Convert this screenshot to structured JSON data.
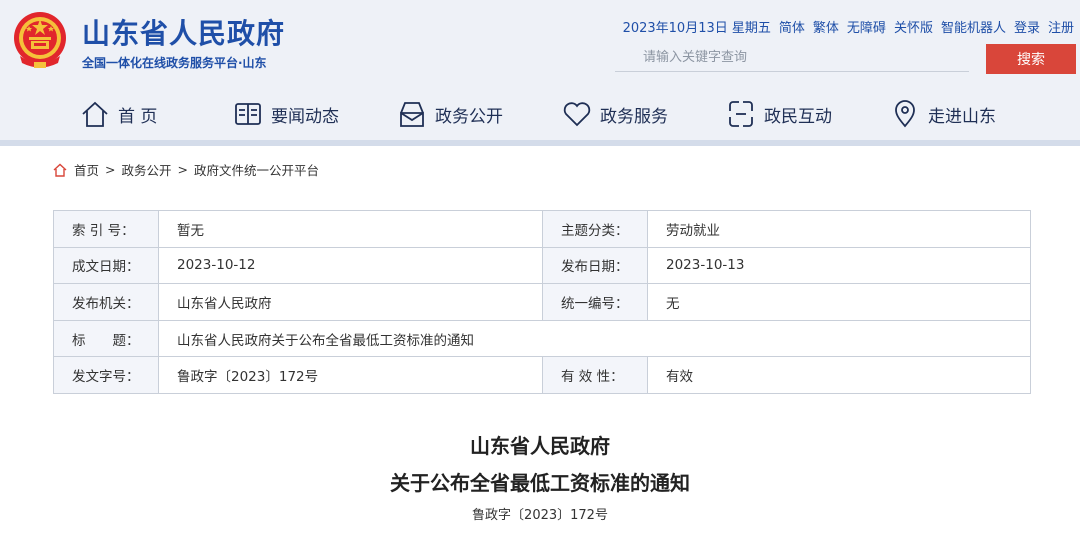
{
  "header": {
    "site_name": "山东省人民政府",
    "site_sub": "全国一体化在线政务服务平台·山东",
    "date": "2023年10月13日 星期五",
    "links": [
      "简体",
      "繁体",
      "无障碍",
      "关怀版",
      "智能机器人",
      "登录",
      "注册"
    ],
    "search_placeholder": "请输入关键字查询",
    "search_button": "搜索"
  },
  "nav": [
    {
      "label": "首 页",
      "icon": "home-icon"
    },
    {
      "label": "要闻动态",
      "icon": "book-icon"
    },
    {
      "label": "政务公开",
      "icon": "mailbox-icon"
    },
    {
      "label": "政务服务",
      "icon": "heart-icon"
    },
    {
      "label": "政民互动",
      "icon": "interaction-icon"
    },
    {
      "label": "走进山东",
      "icon": "location-icon"
    }
  ],
  "breadcrumb": [
    "首页",
    "政务公开",
    "政府文件统一公开平台"
  ],
  "info": {
    "rows": [
      {
        "k1": "索 引 号：",
        "v1": "暂无",
        "k2": "主题分类：",
        "v2": "劳动就业"
      },
      {
        "k1": "成文日期：",
        "v1": "2023-10-12",
        "k2": "发布日期：",
        "v2": "2023-10-13"
      },
      {
        "k1": "发布机关：",
        "v1": "山东省人民政府",
        "k2": "统一编号：",
        "v2": "无"
      },
      {
        "k1": "标　　题：",
        "v1": "山东省人民政府关于公布全省最低工资标准的通知"
      },
      {
        "k1": "发文字号：",
        "v1": "鲁政字〔2023〕172号",
        "k2": "有 效 性：",
        "v2": "有效"
      }
    ]
  },
  "document": {
    "title_line1": "山东省人民政府",
    "title_line2": "关于公布全省最低工资标准的通知",
    "doc_number": "鲁政字〔2023〕172号"
  },
  "colors": {
    "brand_blue": "#1f4fa8",
    "accent_red": "#d9463a"
  }
}
